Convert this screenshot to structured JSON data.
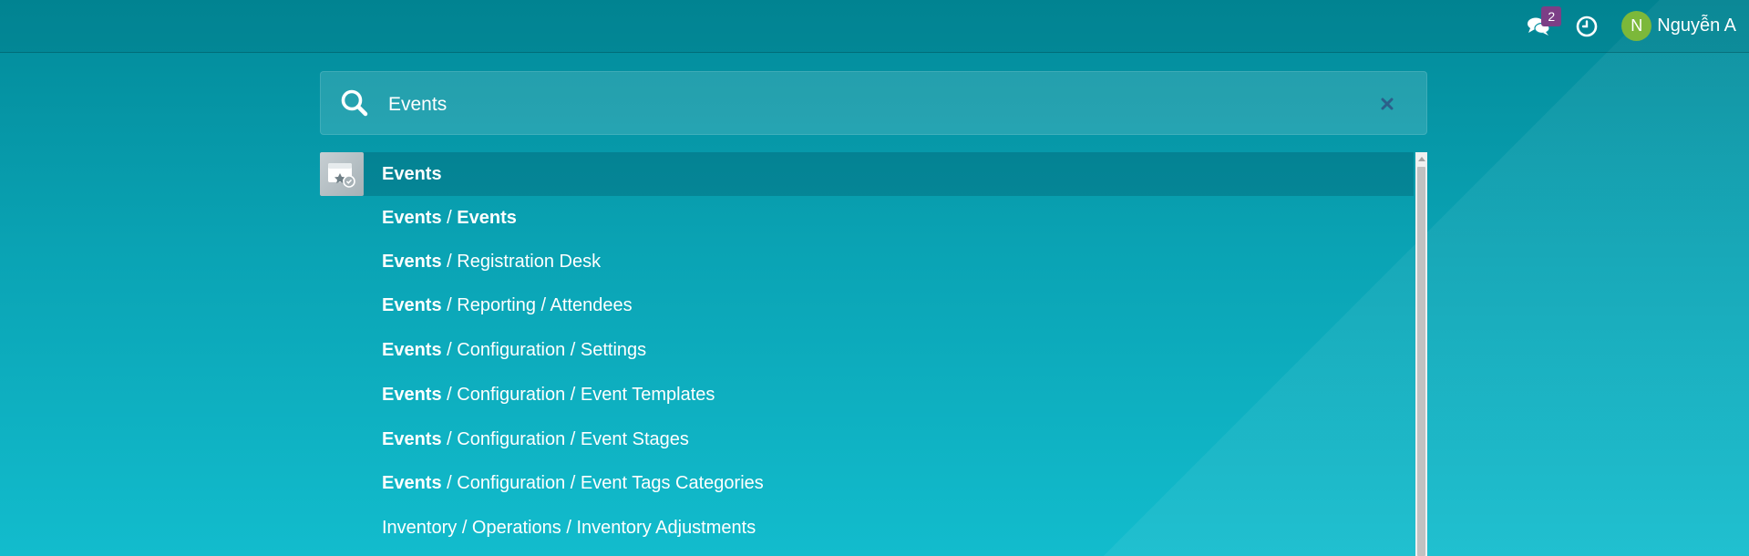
{
  "topbar": {
    "chat_badge": "2",
    "user": {
      "initial": "N",
      "name": "Nguyễn A"
    }
  },
  "search": {
    "value": "Events",
    "placeholder": "Search menus..."
  },
  "results": [
    {
      "bold": "Events",
      "rest": "",
      "icon": "events-app-icon"
    },
    {
      "bold": "Events",
      "rest": " / ",
      "bold2": "Events"
    },
    {
      "bold": "Events",
      "rest": " / Registration Desk"
    },
    {
      "bold": "Events",
      "rest": " / Reporting / Attendees"
    },
    {
      "bold": "Events",
      "rest": " / Configuration / Settings"
    },
    {
      "bold": "Events",
      "rest": " / Configuration / Event Templates"
    },
    {
      "bold": "Events",
      "rest": " / Configuration / Event Stages"
    },
    {
      "bold": "Events",
      "rest": " / Configuration / Event Tags Categories"
    },
    {
      "bold": "",
      "rest": "Inventory / Operations / Inventory Adjustments"
    }
  ],
  "colors": {
    "accent": "#0aa3b4",
    "badge": "#7c3f86",
    "avatar": "#7cb83a"
  }
}
